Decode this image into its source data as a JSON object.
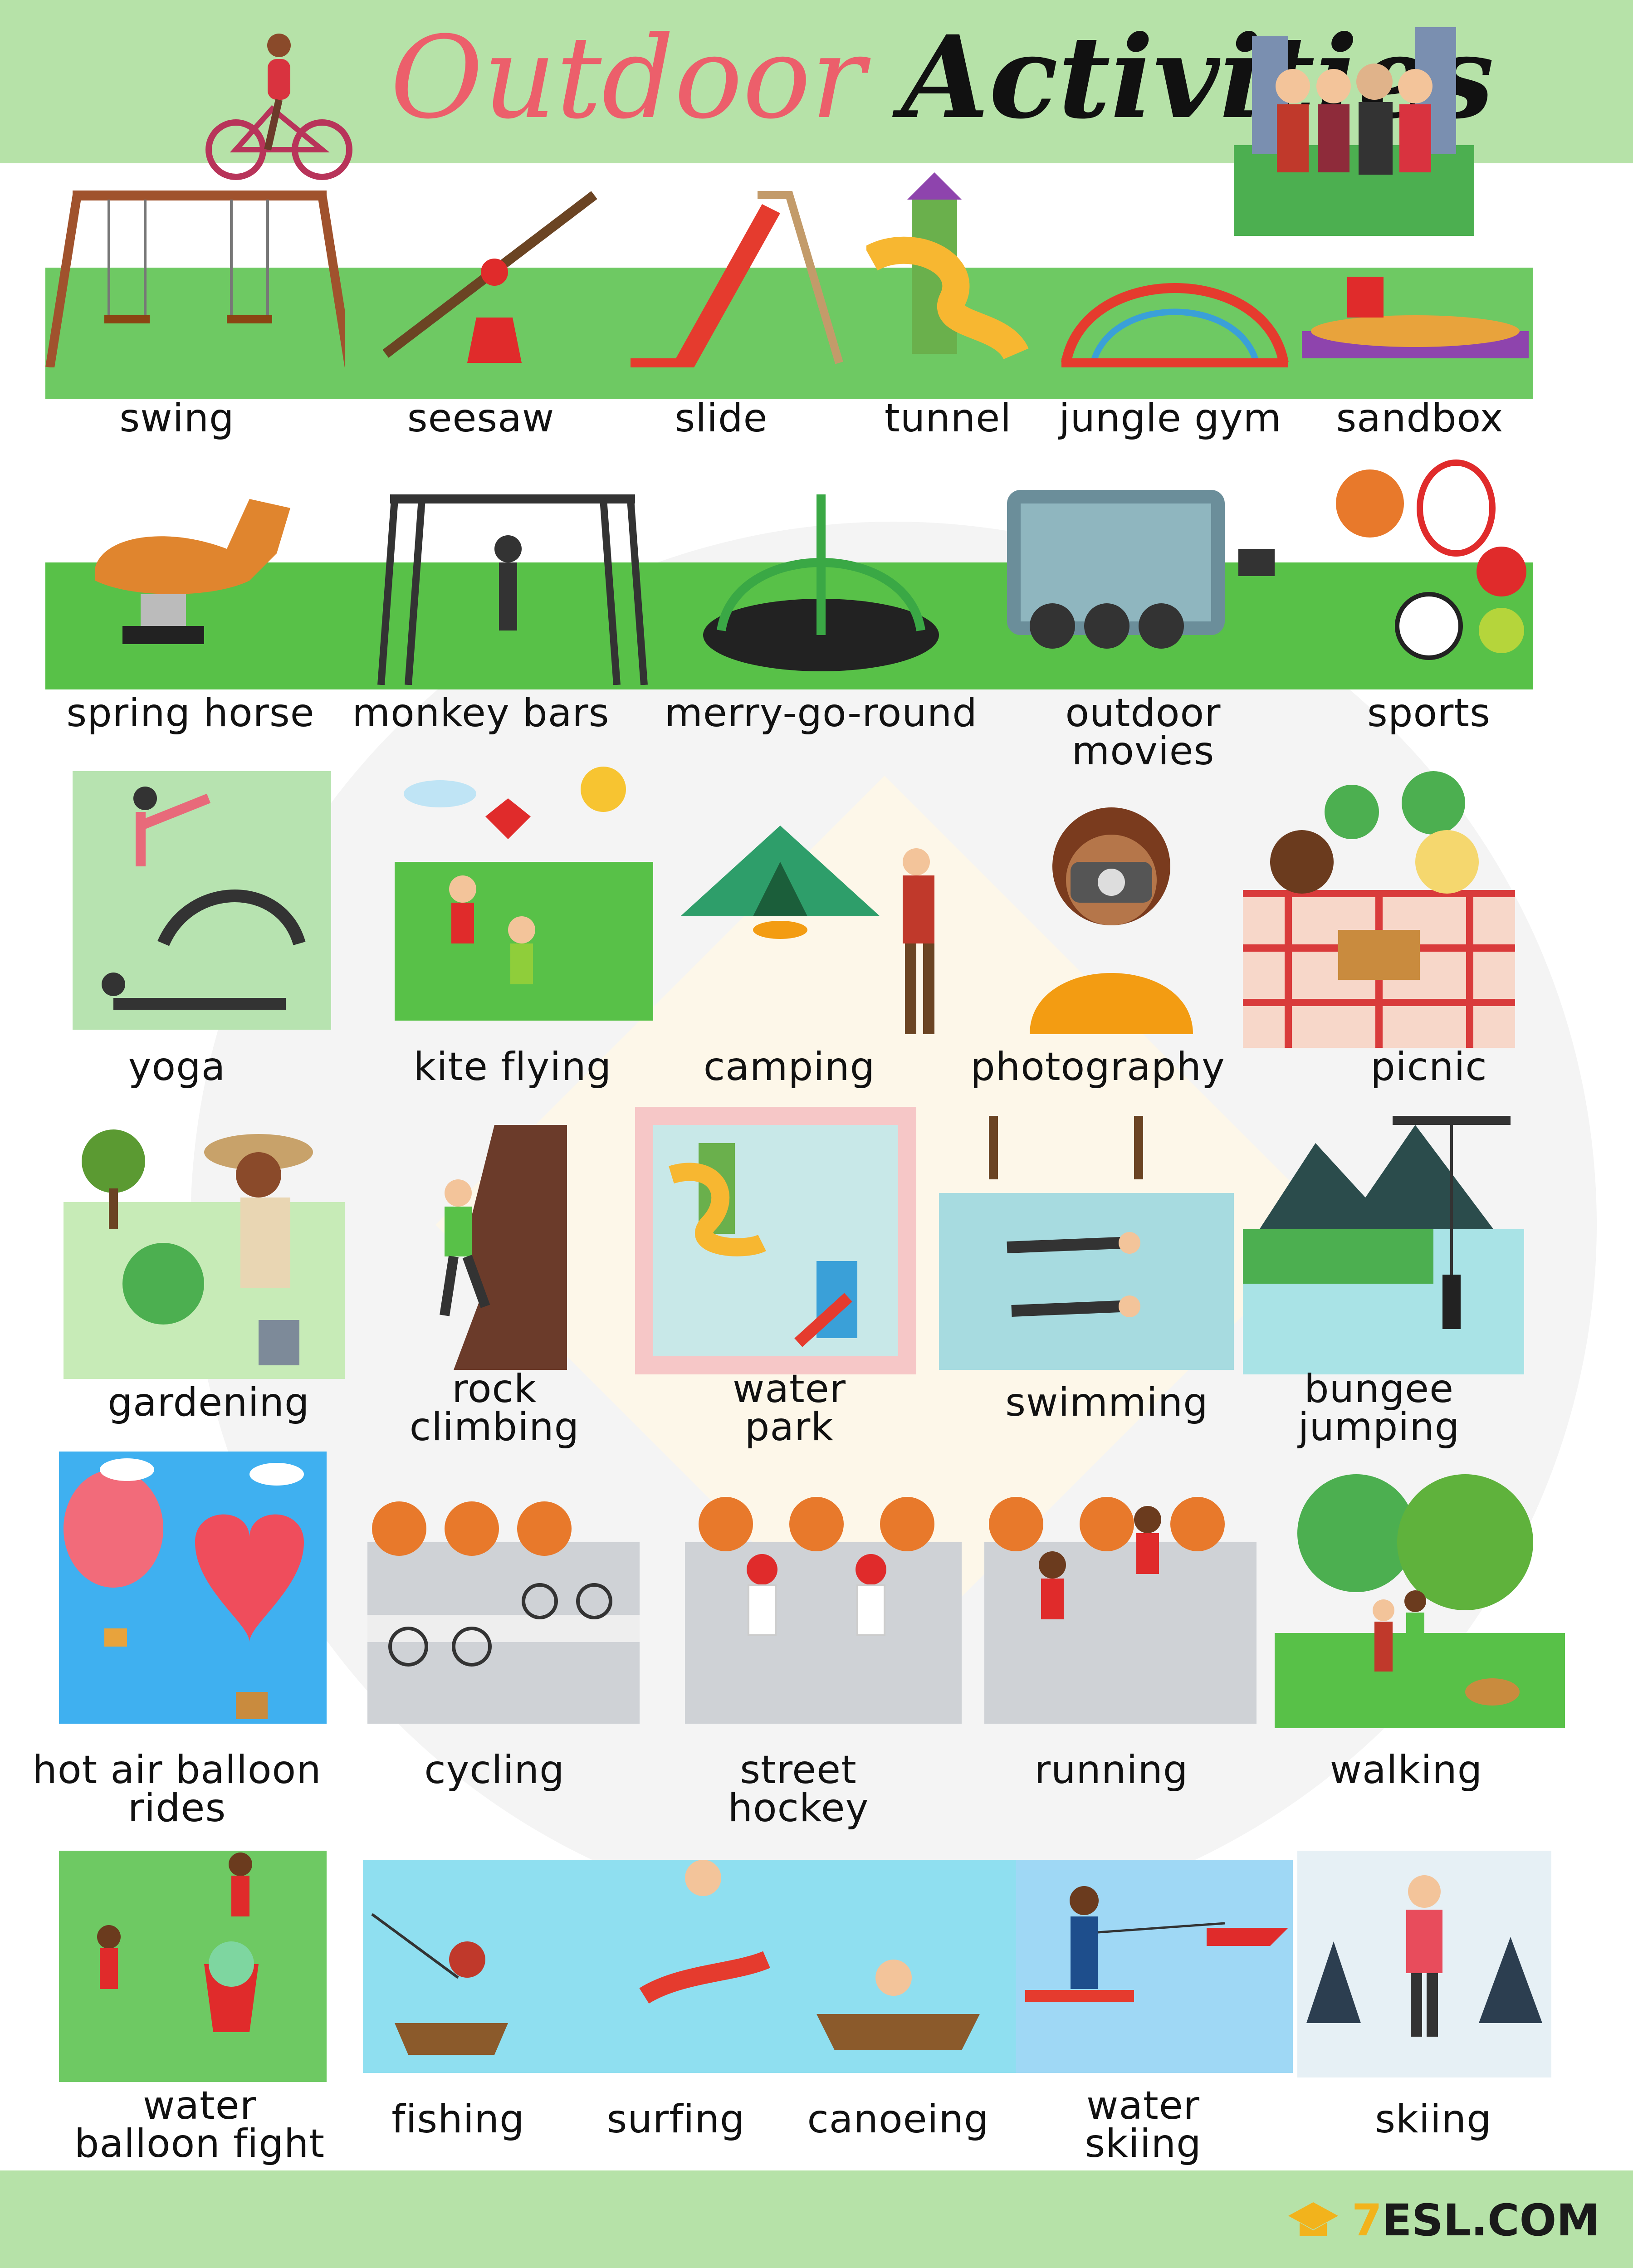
{
  "header": {
    "title_word1": "Outdoor",
    "title_word2": "Activities"
  },
  "colors": {
    "header_band": "#b6e2a8",
    "title_accent": "#ec5f6b",
    "grass": "#6ec963",
    "logo_accent": "#f2b31c"
  },
  "footer": {
    "logo_icon": "graduation-cap-icon",
    "logo_prefix": "7",
    "logo_text": "ESL.COM"
  },
  "activities": [
    {
      "id": "swing",
      "label": "swing"
    },
    {
      "id": "seesaw",
      "label": "seesaw"
    },
    {
      "id": "slide",
      "label": "slide"
    },
    {
      "id": "tunnel",
      "label": "tunnel"
    },
    {
      "id": "jungle-gym",
      "label": "jungle gym"
    },
    {
      "id": "sandbox",
      "label": "sandbox"
    },
    {
      "id": "spring-horse",
      "label": "spring horse"
    },
    {
      "id": "monkey-bars",
      "label": "monkey bars"
    },
    {
      "id": "merry-go-round",
      "label": "merry-go-round"
    },
    {
      "id": "outdoor-movies",
      "label": "outdoor\nmovies"
    },
    {
      "id": "sports",
      "label": "sports"
    },
    {
      "id": "yoga",
      "label": "yoga"
    },
    {
      "id": "kite-flying",
      "label": "kite flying"
    },
    {
      "id": "camping",
      "label": "camping"
    },
    {
      "id": "photography",
      "label": "photography"
    },
    {
      "id": "picnic",
      "label": "picnic"
    },
    {
      "id": "gardening",
      "label": "gardening"
    },
    {
      "id": "rock-climbing",
      "label": "rock\nclimbing"
    },
    {
      "id": "water-park",
      "label": "water\npark"
    },
    {
      "id": "swimming",
      "label": "swimming"
    },
    {
      "id": "bungee-jumping",
      "label": "bungee\njumping"
    },
    {
      "id": "hot-air-balloon-rides",
      "label": "hot air balloon\nrides"
    },
    {
      "id": "cycling",
      "label": "cycling"
    },
    {
      "id": "street-hockey",
      "label": "street\nhockey"
    },
    {
      "id": "running",
      "label": "running"
    },
    {
      "id": "walking",
      "label": "walking"
    },
    {
      "id": "water-balloon-fight",
      "label": "water\nballoon fight"
    },
    {
      "id": "fishing",
      "label": "fishing"
    },
    {
      "id": "surfing",
      "label": "surfing"
    },
    {
      "id": "canoeing",
      "label": "canoeing"
    },
    {
      "id": "water-skiing",
      "label": "water\nskiing"
    },
    {
      "id": "skiing",
      "label": "skiing"
    }
  ]
}
